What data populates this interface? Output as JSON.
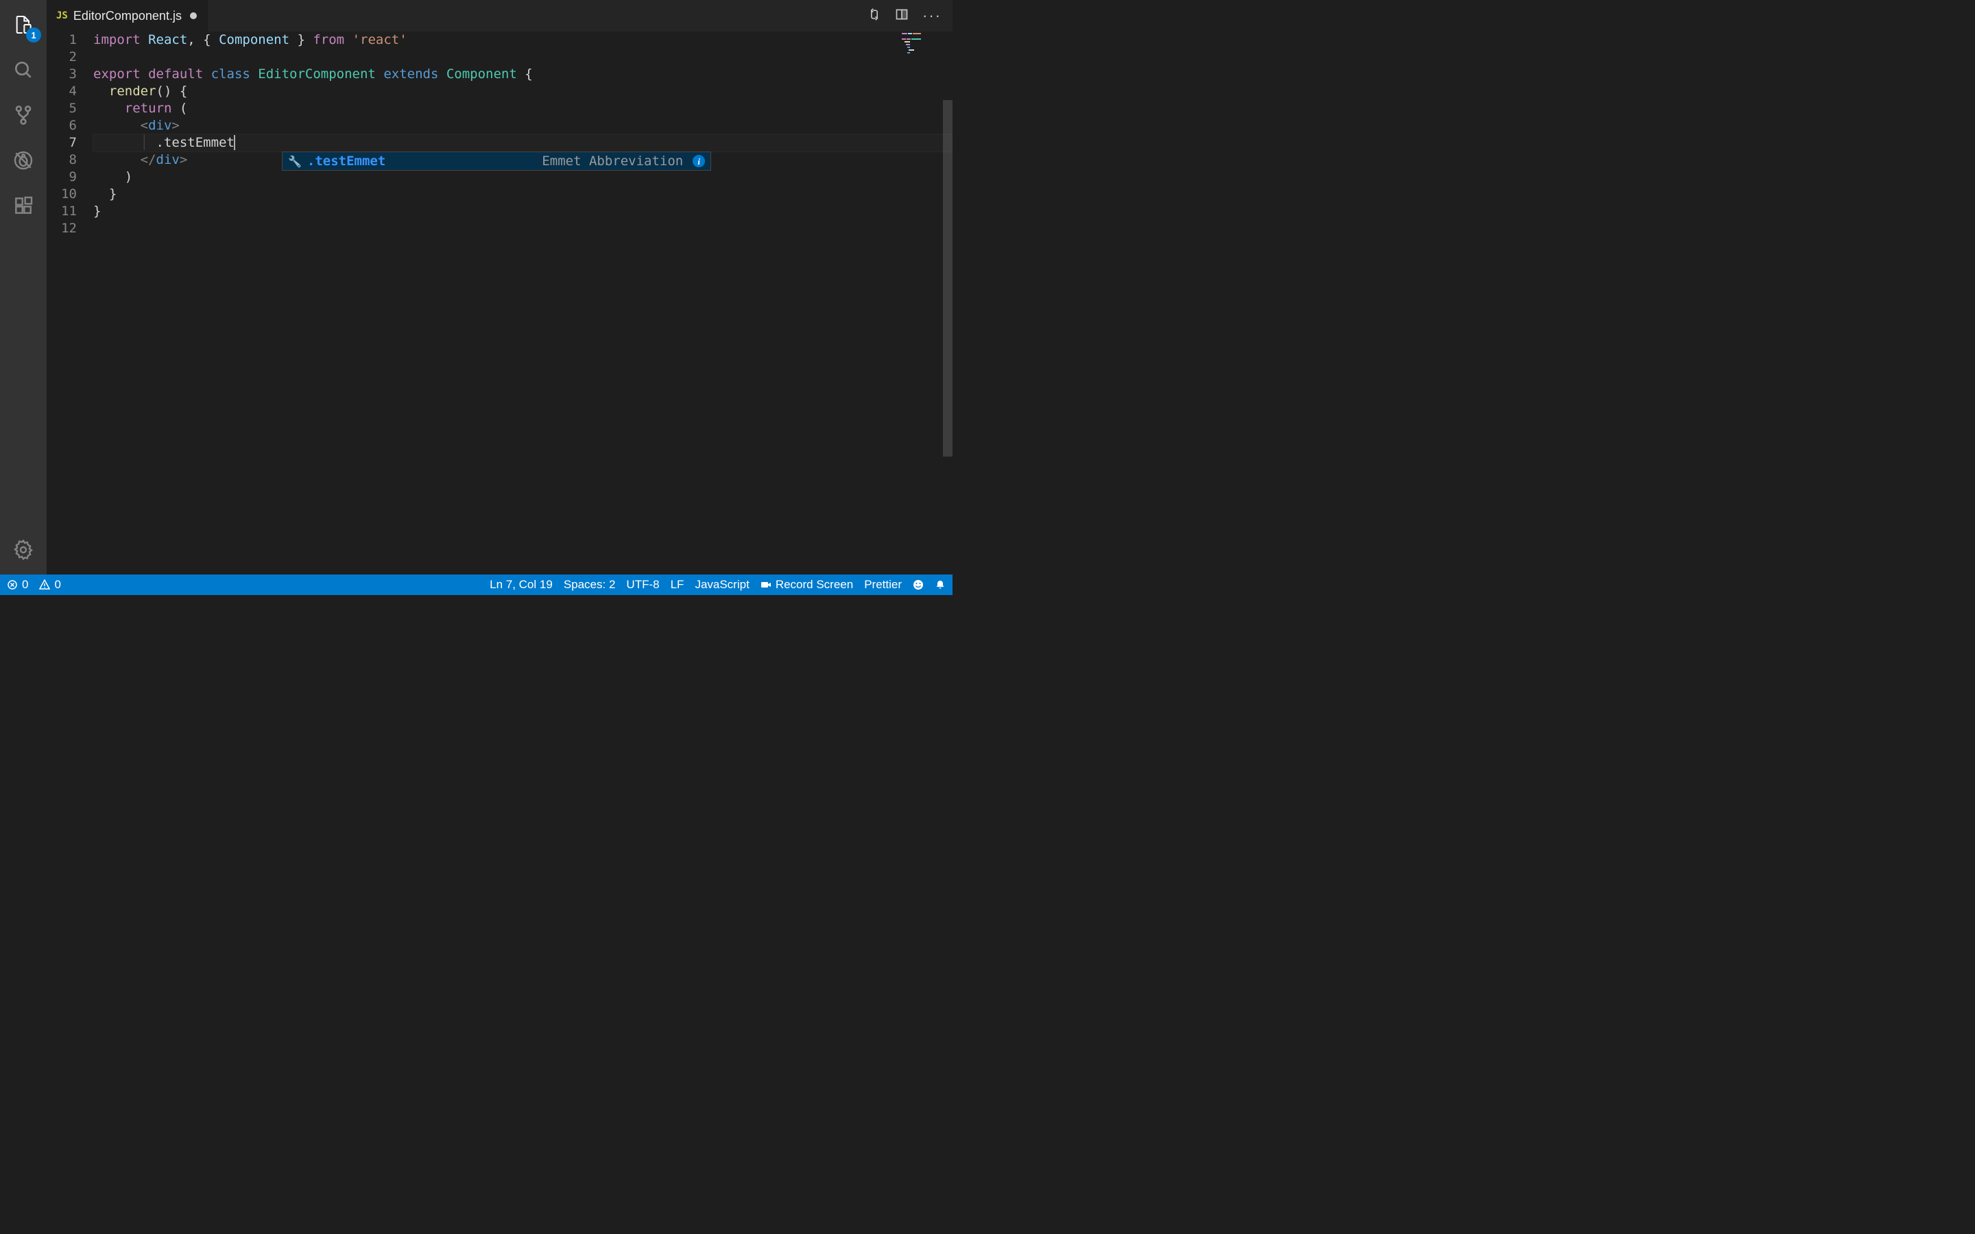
{
  "activityBar": {
    "explorerBadge": "1"
  },
  "tab": {
    "fileIcon": "JS",
    "fileName": "EditorComponent.js"
  },
  "code": {
    "line1": {
      "import": "import",
      "react": "React",
      "comma": ", { ",
      "component": "Component",
      "close": " } ",
      "from": "from",
      "str": "'react'",
      "space": " "
    },
    "line3": {
      "export": "export",
      "default": "default",
      "class": "class",
      "name": "EditorComponent",
      "extends": "extends",
      "component": "Component",
      "brace": " {"
    },
    "line4": {
      "render": "render",
      "rest": "() {"
    },
    "line5": {
      "return": "return",
      "rest": " ("
    },
    "line6": {
      "open": "<",
      "tag": "div",
      "close": ">"
    },
    "line7": {
      "text": ".testEmmet"
    },
    "line8": {
      "open": "</",
      "tag": "div",
      "close": ">"
    },
    "line9": {
      "text": ")"
    },
    "line10": {
      "text": "}"
    },
    "line11": {
      "text": "}"
    }
  },
  "suggestion": {
    "label": ".testEmmet",
    "desc": "Emmet Abbreviation",
    "info": "i"
  },
  "statusBar": {
    "errors": "0",
    "warnings": "0",
    "lineCol": "Ln 7, Col 19",
    "spaces": "Spaces: 2",
    "encoding": "UTF-8",
    "eol": "LF",
    "language": "JavaScript",
    "record": "Record Screen",
    "prettier": "Prettier"
  }
}
